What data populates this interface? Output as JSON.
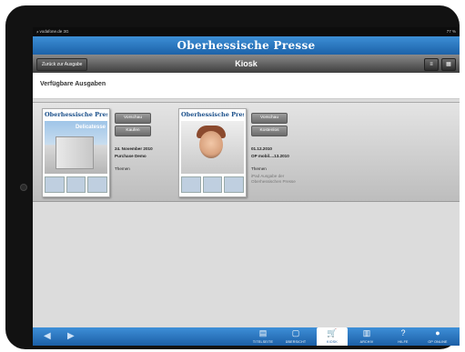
{
  "status_bar": {
    "carrier": "ᵢₗₗ vodafone.de 3G",
    "battery": "77 %"
  },
  "brand": {
    "logo_text": "Oberhessische Presse"
  },
  "nav": {
    "back_label": "Zurück zur Ausgabe",
    "title": "Kiosk",
    "view_icons": [
      "≡",
      "▦"
    ]
  },
  "section": {
    "title": "Verfügbare Ausgaben"
  },
  "issues": [
    {
      "masthead": "Oberhessische Presse",
      "cover_headline": "Delicatesse",
      "preview_label": "Vorschau",
      "action_label": "Kaufen",
      "date": "24. November 2010",
      "name": "Purchase Demo",
      "themen": "Themen",
      "description": ""
    },
    {
      "masthead": "Oberhessische Presse",
      "cover_headline": "",
      "preview_label": "Vorschau",
      "action_label": "Kostenlos",
      "date": "01.12.2010",
      "name": "OP mobil....13.2010",
      "themen": "Themen",
      "description": "iPad Ausgabe der Oberhessischen Presse"
    }
  ],
  "tabbar": {
    "arrows": [
      "◀",
      "▶"
    ],
    "tabs": [
      {
        "icon": "▤",
        "label": "TITELSEITE"
      },
      {
        "icon": "▢",
        "label": "ÜBERSICHT"
      },
      {
        "icon": "🛒",
        "label": "KIOSK"
      },
      {
        "icon": "▥",
        "label": "ARCHIV"
      },
      {
        "icon": "?",
        "label": "HILFE"
      },
      {
        "icon": "●",
        "label": "OP ONLINE"
      }
    ],
    "active_tab": "KIOSK"
  },
  "colors": {
    "brand_blue": "#1c62a8",
    "tab_blue": "#3e8fd8",
    "bezel": "#121212"
  }
}
